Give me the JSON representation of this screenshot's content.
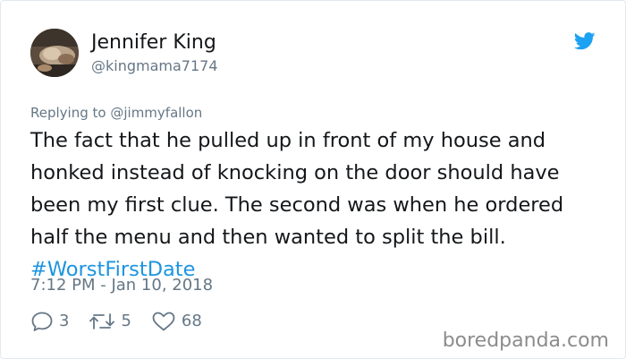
{
  "tweet": {
    "author": {
      "name": "Jennifer King",
      "handle": "@kingmama7174"
    },
    "replying": {
      "prefix": "Replying to",
      "mention": "@jimmyfallon"
    },
    "text_lines": [
      "The fact that he pulled up in front of my house and",
      "honked instead of knocking on the door should have",
      "been my first clue. The second was when he ordered",
      "half the menu and then wanted to split the bill."
    ],
    "hashtag": "#WorstFirstDate",
    "timestamp": "7:12 PM - Jan 10, 2018",
    "stats": {
      "replies": "3",
      "retweets": "5",
      "likes": "68"
    }
  },
  "icons": {
    "brand": "twitter-bird-icon",
    "reply": "reply-icon",
    "retweet": "retweet-icon",
    "like": "heart-icon"
  },
  "colors": {
    "brand_blue": "#1da1f2",
    "link_blue": "#1b95e0",
    "muted_text": "#657786",
    "body_text": "#14171a",
    "border": "#e1e8ed",
    "watermark": "#8c8c8c"
  },
  "watermark": "boredpanda.com"
}
